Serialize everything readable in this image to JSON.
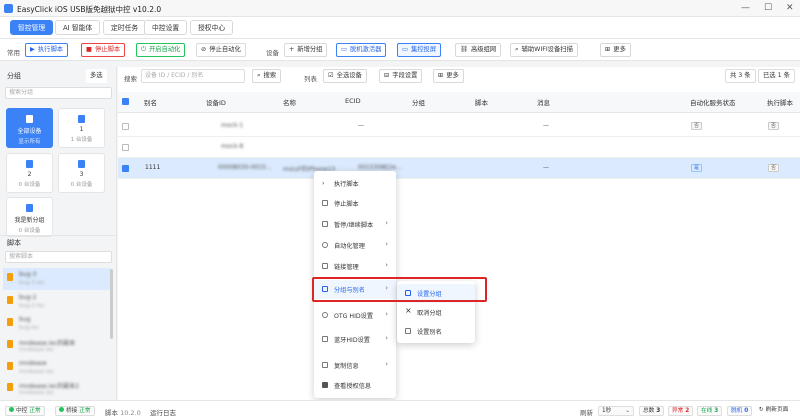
{
  "window": {
    "title": "EasyClick iOS USB版免越狱中控 v10.2.0",
    "min": "—",
    "max": "☐",
    "close": "✕"
  },
  "tabs": [
    "智控管理",
    "AI 智能体",
    "定时任务",
    "中控设置",
    "授权中心"
  ],
  "toolbar": {
    "common_label": "常用",
    "run": "执行脚本",
    "stop": "停止脚本",
    "auto_on": "开启自动化",
    "auto_off": "停止自动化",
    "device_label": "设备",
    "add_group": "新增分组",
    "activate": "脱机激活器",
    "mirror": "集控投屏",
    "advanced": "高级组网",
    "wifi_scan": "辅助WIFI设备扫描",
    "more": "更多"
  },
  "sidebar": {
    "group_header": "分组",
    "multi_select": "多选",
    "group_search_placeholder": "搜索分组",
    "groups": [
      {
        "name": "全部设备",
        "sub": "显示所有"
      },
      {
        "name": "1",
        "sub": "1 台设备"
      },
      {
        "name": "2",
        "sub": "0 台设备"
      },
      {
        "name": "3",
        "sub": "0 台设备"
      },
      {
        "name": "我是新分组",
        "sub": "0 台设备"
      }
    ],
    "script_header": "脚本",
    "script_search_placeholder": "搜索脚本",
    "scripts": [
      {
        "name": "bug-3",
        "path": "bug-3.iec"
      },
      {
        "name": "bug-2",
        "path": "bug-2.iec"
      },
      {
        "name": "bug",
        "path": "bug.iec"
      },
      {
        "name": "mndease.iec的副本",
        "path": "mndease.iec"
      },
      {
        "name": "mndease",
        "path": "mndease.iec"
      },
      {
        "name": "mndease.iec的副本2",
        "path": "mndease.iec"
      }
    ]
  },
  "filterbar": {
    "search_label": "搜索",
    "search_placeholder": "设备 ID / ECID / 别名",
    "search_btn": "搜索",
    "columns_label": "列表",
    "select_all": "全选设备",
    "field_settings": "字段设置",
    "more": "更多",
    "total": "共 3 条",
    "selected": "已选 1 条"
  },
  "table": {
    "headers": [
      "别名",
      "设备ID",
      "名称",
      "ECID",
      "分组",
      "脚本",
      "消息",
      "自动化服务状态",
      "执行脚本"
    ],
    "rows": [
      {
        "alias": "",
        "device_id": "mock-1",
        "name": "",
        "ecid": "—",
        "group": "",
        "script": "",
        "msg": "—",
        "auto": "否",
        "exec": "否"
      },
      {
        "alias": "",
        "device_id": "mock-8",
        "name": "",
        "ecid": "",
        "group": "",
        "script": "",
        "msg": "",
        "auto": "",
        "exec": ""
      },
      {
        "alias": "1111",
        "device_id": "00008030-0015...",
        "name": "mxiuF的iPhone13",
        "ecid": "0015308E2e...",
        "group": "",
        "script": "",
        "msg": "—",
        "auto": "是",
        "exec": "否"
      }
    ]
  },
  "context_menu": [
    "执行脚本",
    "停止脚本",
    "暂停/继续脚本",
    "自动化管理",
    "链接管理",
    "分组与别名",
    "OTG HID设置",
    "蓝牙HID设置",
    "复制信息",
    "查看授权信息"
  ],
  "submenu": [
    "设置分组",
    "取消分组",
    "设置别名"
  ],
  "status": {
    "hub": "中控",
    "hub_state": "正常",
    "bridge": "桥接",
    "bridge_state": "正常",
    "script_label": "脚本",
    "version": "10.2.0",
    "run_log": "运行日志",
    "refresh_label": "刷新",
    "refresh_value": "1秒",
    "total_label": "总数",
    "total": "3",
    "abnormal_label": "异常",
    "abnormal": "2",
    "online_label": "在线",
    "online": "3",
    "offline_label": "脱机",
    "offline": "0",
    "refresh_page": "刷新页面"
  },
  "colors": {
    "accent": "#3b82f6",
    "danger": "#dc2626",
    "success": "#16a34a"
  }
}
